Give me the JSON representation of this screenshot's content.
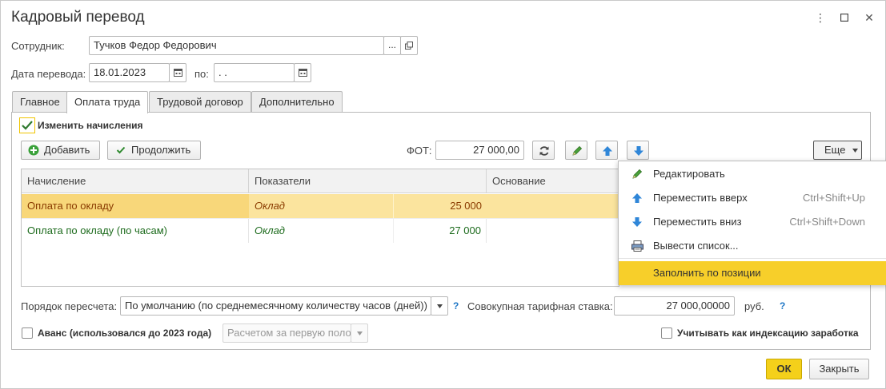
{
  "window": {
    "title": "Кадровый перевод",
    "controls": {
      "more": "⋮",
      "maximize": "☐",
      "close": "✕"
    }
  },
  "employee": {
    "label": "Сотрудник:",
    "value": "Тучков Федор Федорович",
    "select_btn": "...",
    "open_btn": "⧉"
  },
  "date": {
    "label": "Дата перевода:",
    "value": "18.01.2023",
    "to_label": "по:",
    "to_value": " .  ."
  },
  "tabs": [
    {
      "label": "Главное"
    },
    {
      "label": "Оплата труда"
    },
    {
      "label": "Трудовой договор"
    },
    {
      "label": "Дополнительно"
    }
  ],
  "change_accruals": {
    "label": "Изменить начисления",
    "checked": true
  },
  "toolbar": {
    "add_label": "Добавить",
    "continue_label": "Продолжить",
    "fot_label": "ФОТ:",
    "fot_value": "27 000,00",
    "more_label": "Еще"
  },
  "table": {
    "columns": [
      "Начисление",
      "Показатели",
      "Основание"
    ],
    "rows": [
      {
        "accrual": "Оплата по окладу",
        "indicator": "Оклад",
        "value": "25 000",
        "selected": true
      },
      {
        "accrual": "Оплата по окладу (по часам)",
        "indicator": "Оклад",
        "value": "27 000",
        "selected": false
      }
    ]
  },
  "menu": {
    "items": [
      {
        "label": "Редактировать",
        "shortcut": "",
        "icon": "pencil-icon"
      },
      {
        "label": "Переместить вверх",
        "shortcut": "Ctrl+Shift+Up",
        "icon": "arrow-up-icon"
      },
      {
        "label": "Переместить вниз",
        "shortcut": "Ctrl+Shift+Down",
        "icon": "arrow-down-icon"
      },
      {
        "label": "Вывести список...",
        "shortcut": "",
        "icon": "print-list-icon"
      },
      {
        "label": "Заполнить по позиции",
        "shortcut": "",
        "icon": "",
        "highlighted": true
      }
    ]
  },
  "recalc": {
    "label": "Порядок пересчета:",
    "value": "По умолчанию (по среднемесячному количеству часов (дней))",
    "help": "?"
  },
  "tariff": {
    "label": "Совокупная тарифная ставка:",
    "value": "27 000,00000",
    "unit": "руб.",
    "help": "?"
  },
  "advance": {
    "label": "Аванс (использовался до 2023 года)",
    "value": "Расчетом за первую поло",
    "checked": false
  },
  "indexation": {
    "label": "Учитывать как индексацию заработка",
    "checked": false
  },
  "footer": {
    "ok_label": "ОК",
    "close_label": "Закрыть"
  },
  "colors": {
    "selected_row": "#fbe49e",
    "selected_cell": "#f8d77a",
    "accrual_text": "#8a3b00",
    "green_text": "#1d6b1d",
    "menu_highlight": "#f7cf2a",
    "ok_button": "#f4d01a",
    "accent_blue": "#2f86d8"
  }
}
